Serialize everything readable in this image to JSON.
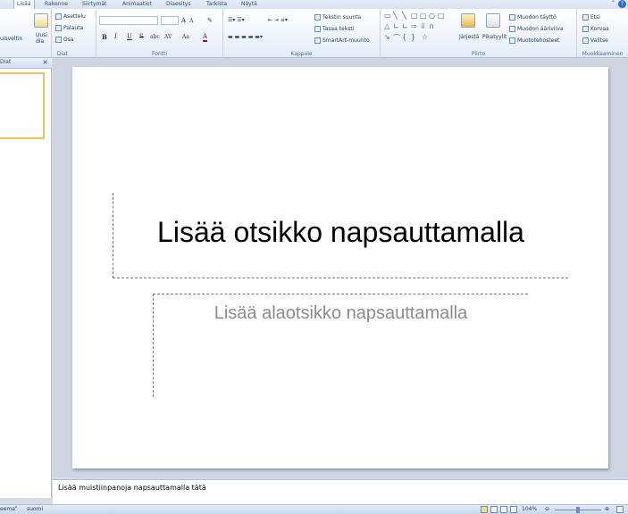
{
  "tabs": [
    "Lisää",
    "Rakenne",
    "Siirtymät",
    "Animaatiot",
    "Diaesitys",
    "Tarkista",
    "Näytä"
  ],
  "ribbon": {
    "groups": [
      "Diat",
      "Fontti",
      "Kappale",
      "Piirto",
      "Muokkaaminen"
    ],
    "diat": {
      "new_slide_line1": "Uusi",
      "new_slide_line2": "dia",
      "layout": "Asettelu",
      "reset": "Palauta",
      "section": "Osa",
      "left_cut": "uisveltin"
    },
    "fontti": {
      "grow": "A",
      "shrink": "A",
      "bold": "B",
      "italic": "I",
      "underline": "U",
      "strike": "S",
      "shadow": "abc",
      "spacing": "AV",
      "case": "Aa",
      "color": "A"
    },
    "kappale": {
      "text_direction": "Tekstin suunta",
      "align_text": "Tasaa teksti",
      "smartart": "SmartArt-muunto"
    },
    "piirto": {
      "arrange": "Järjestä",
      "quick_styles": "Pikatyylit",
      "shape_fill": "Muodon täyttö",
      "shape_outline": "Muodon ääriviiva",
      "shape_effects": "Muototehosteet"
    },
    "muokkaaminen": {
      "find": "Etsi",
      "replace": "Korvaa",
      "select": "Valitse"
    }
  },
  "left_panel": {
    "tab": "Diat",
    "close": "×"
  },
  "slide": {
    "title_placeholder": "Lisää otsikko napsauttamalla",
    "subtitle_placeholder": "Lisää alaotsikko napsauttamalla"
  },
  "notes": {
    "placeholder": "Lisää muistiinpanoja napsauttamalla tätä"
  },
  "status": {
    "theme": "eema\"",
    "language": "suomi",
    "zoom": "104%",
    "zoom_level_percent": 104
  },
  "colors": {
    "ribbon_bg": "#e4ecf7",
    "accent": "#2d6ccf",
    "selection": "#f1c35b"
  }
}
